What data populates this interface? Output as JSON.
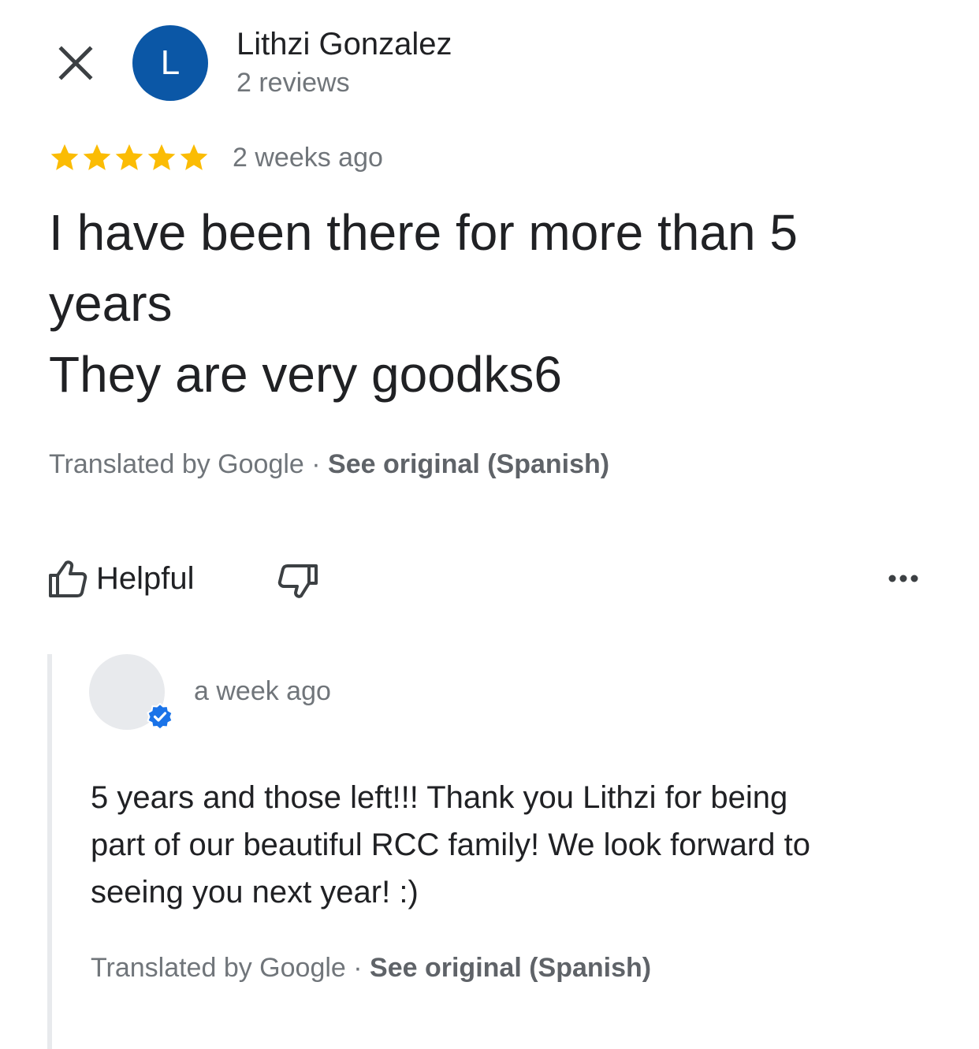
{
  "header": {
    "close_icon": "close-icon",
    "avatar_letter": "L",
    "avatar_color": "#0b57a6",
    "reviewer_name": "Lithzi Gonzalez",
    "reviewer_reviews": "2 reviews"
  },
  "review": {
    "rating": 5,
    "rating_max": 5,
    "star_color": "#fbbc04",
    "date": "2 weeks ago",
    "text_lines": [
      "I have been there for more than 5",
      "years",
      "They are very goodks6"
    ],
    "translated_by": "Translated by Google · ",
    "see_original": "See original (Spanish)"
  },
  "actions": {
    "helpful_label": "Helpful",
    "helpful_icon": "thumbs-up-icon",
    "not_helpful_icon": "thumbs-down-icon",
    "more_icon": "more-horizontal-icon"
  },
  "reply": {
    "date": "a week ago",
    "verified_icon": "verified-badge-icon",
    "verified_color": "#1a73e8",
    "text_lines": [
      "5 years and those left!!! Thank you Lithzi for being",
      "part of our beautiful RCC family! We look forward to",
      "seeing you next year! :)"
    ],
    "translated_by": "Translated by Google · ",
    "see_original": "See original (Spanish)"
  }
}
